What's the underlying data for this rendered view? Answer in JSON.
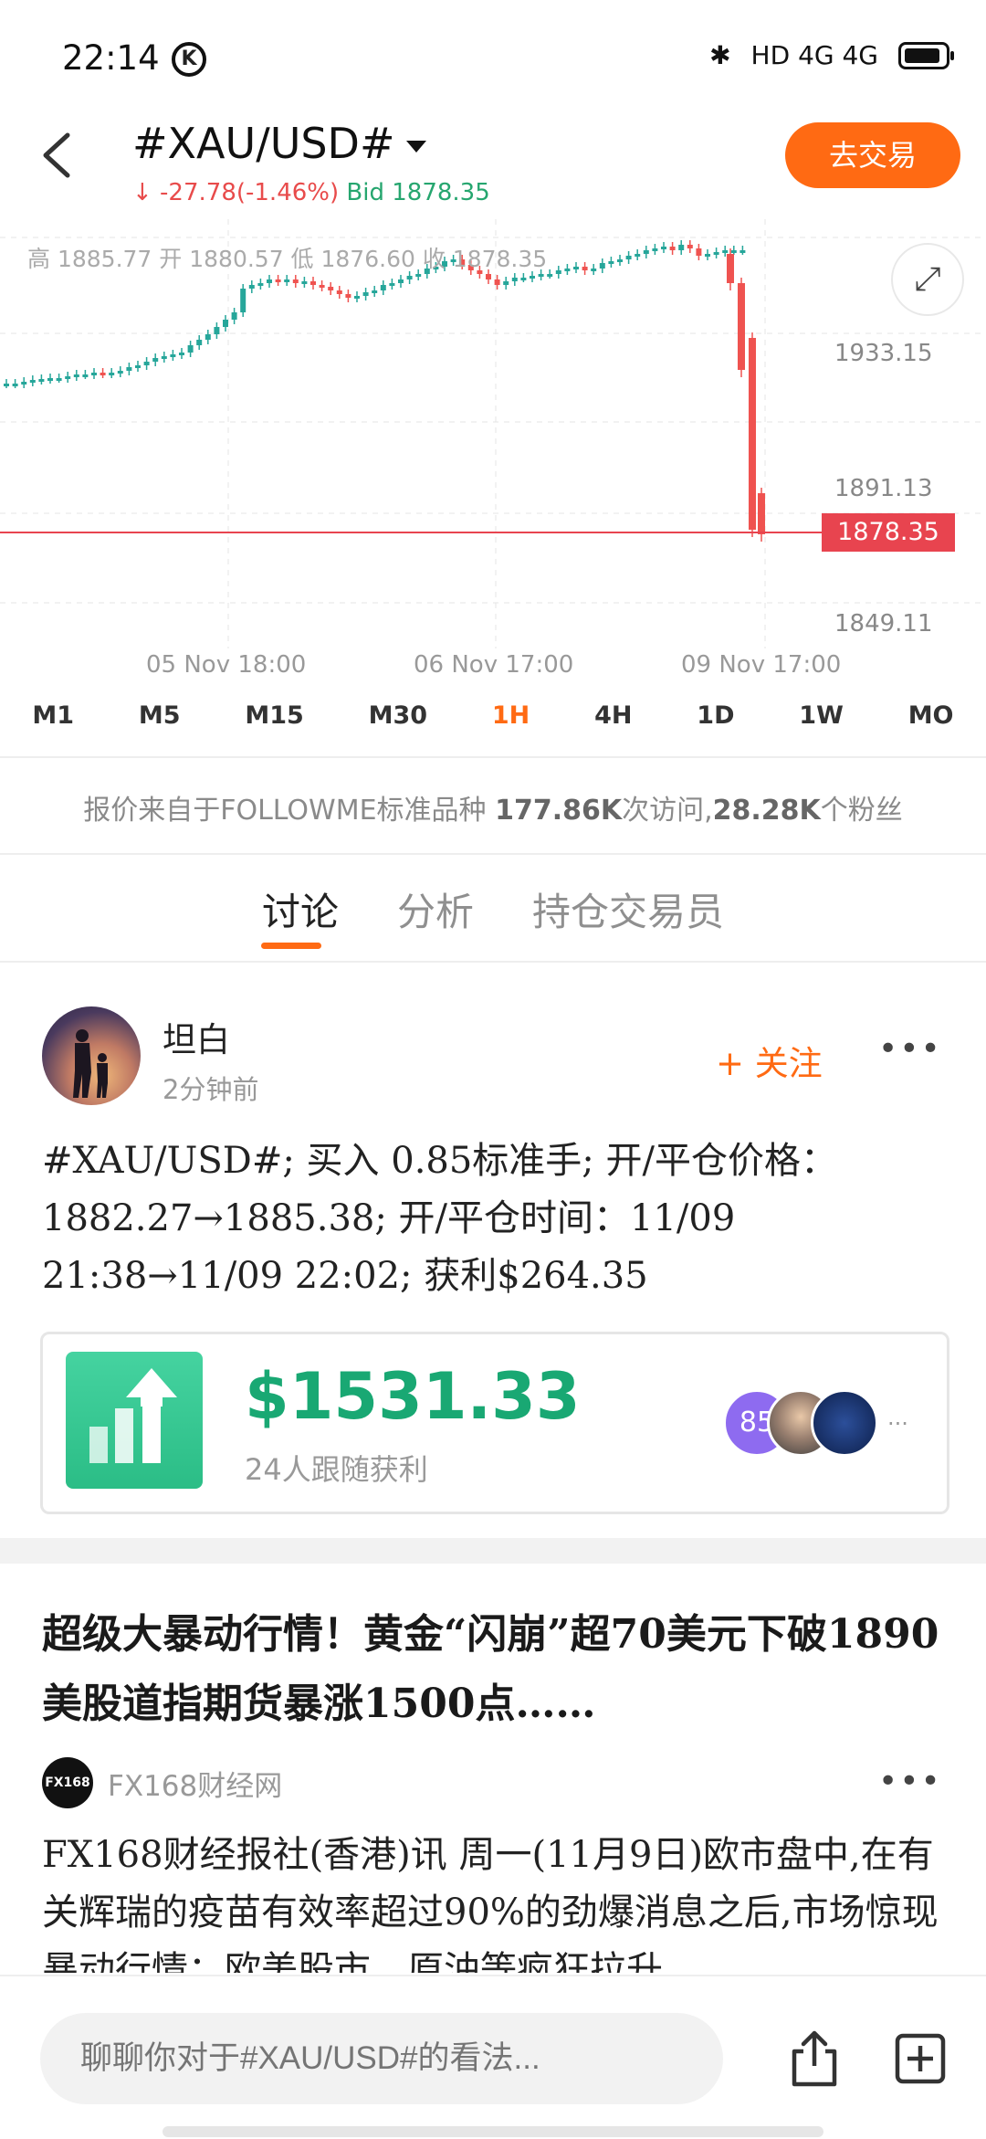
{
  "status_bar": {
    "time": "22:14",
    "badge": "K",
    "indicators": "HD 4G 4G"
  },
  "header": {
    "symbol": "#XAU/USD#",
    "change": "↓ -27.78(-1.46%)",
    "bid": "Bid 1878.35",
    "trade_button": "去交易"
  },
  "chart": {
    "ohlc": "高 1885.77  开 1880.57  低 1876.60  收 1878.35",
    "price_levels": [
      "1933.15",
      "1891.13",
      "1849.11"
    ],
    "current_price": "1878.35",
    "dates": [
      "05 Nov  18:00",
      "06 Nov  17:00",
      "09 Nov  17:00"
    ],
    "colors": {
      "up": "#26a69a",
      "down": "#ef5350"
    }
  },
  "timeframes": [
    "M1",
    "M5",
    "M15",
    "M30",
    "1H",
    "4H",
    "1D",
    "1W",
    "MO"
  ],
  "active_timeframe": "1H",
  "info": {
    "prefix": "报价来自于FOLLOWME标准品种 ",
    "visits": "177.86K",
    "visits_label": "次访问,",
    "fans": "28.28K",
    "fans_label": "个粉丝"
  },
  "tabs": [
    "讨论",
    "分析",
    "持仓交易员"
  ],
  "post": {
    "username": "坦白",
    "time": "2分钟前",
    "follow": "+ 关注",
    "more": "•••",
    "body": "#XAU/USD#; 买入 0.85标准手; 开/平仓价格：1882.27→1885.38; 开/平仓时间：11/09 21:38→11/09 22:02; 获利$264.35",
    "profit_amount": "$1531.33",
    "profit_label": "24人跟随获利",
    "follower_badge": "85",
    "more_followers": "..."
  },
  "news": {
    "title": "超级大暴动行情！黄金“闪崩”超70美元下破1890 美股道指期货暴涨1500点……",
    "source_logo": "FX168",
    "source": "FX168财经网",
    "more": "•••",
    "body": "FX168财经报社(香港)讯 周一(11月9日)欧市盘中,在有关辉瑞的疫苗有效率超过90%的劲爆消息之后,市场惊现暴动行情：欧美股市、原油等疯狂拉升"
  },
  "comment": {
    "placeholder": "聊聊你对于#XAU/USD#的看法..."
  }
}
